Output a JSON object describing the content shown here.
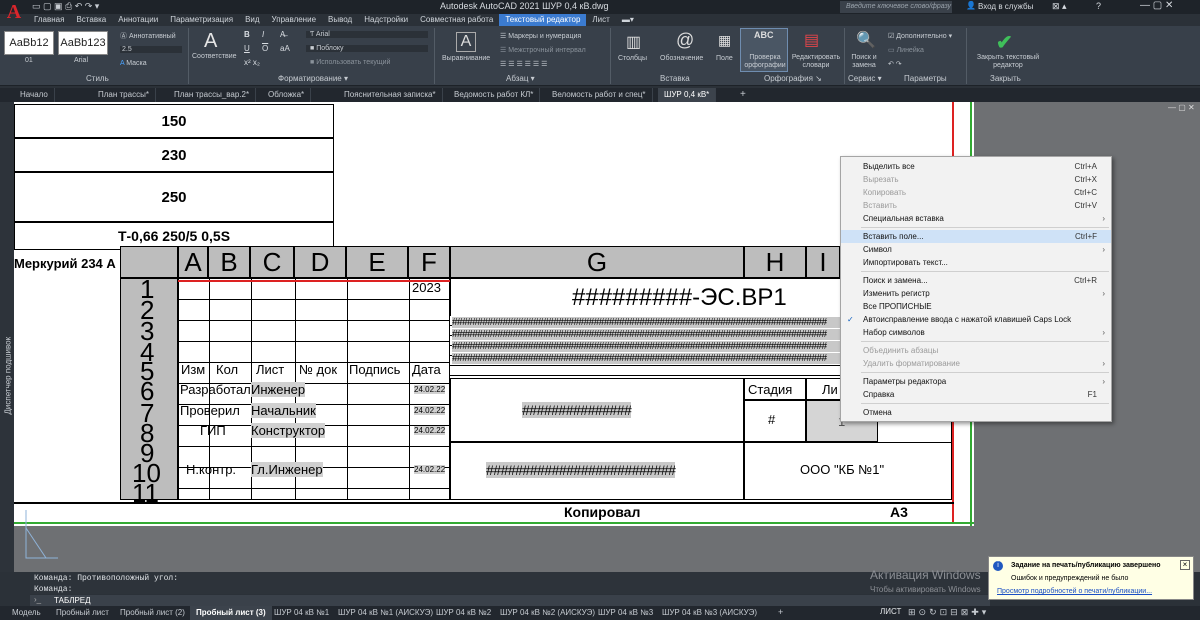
{
  "app": {
    "title": "Autodesk AutoCAD 2021   ШУР 0,4 кВ.dwg",
    "search_placeholder": "Введите ключевое слово/фразу",
    "signin": "Вход в службы",
    "help": "?"
  },
  "menu_tabs": [
    "Главная",
    "Вставка",
    "Аннотации",
    "Параметризация",
    "Вид",
    "Управление",
    "Вывод",
    "Надстройки",
    "Совместная работа",
    "Текстовый редактор",
    "Лист"
  ],
  "ribbon": {
    "style_samples": [
      "AaBb12",
      "AaBb123"
    ],
    "style_names": [
      "01",
      "Arial"
    ],
    "annotative": "Аннотативный",
    "height": "2.5",
    "mask": "Маска",
    "match": "Соответствие",
    "font": "Arial",
    "color": "Поблоку",
    "use_current": "Использовать текущий",
    "justify": "Выравнивание",
    "bullets": "Маркеры и нумерация",
    "line_spacing": "Межстрочный интервал",
    "columns": "Столбцы",
    "symbol": "Обозначение",
    "field": "Поле",
    "spell": "Проверка орфографии",
    "dict": "Редактировать словари",
    "find": "Поиск и замена",
    "more": "Дополнительно",
    "ruler": "Линейка",
    "close": "Закрыть текстовый редактор",
    "groups": [
      "Стиль",
      "Форматирование",
      "Абзац",
      "Вставка",
      "Орфография",
      "Сервис",
      "Параметры",
      "Закрыть"
    ]
  },
  "doc_tabs": [
    "Начало",
    "План трассы*",
    "План трассы_вар.2*",
    "Обложка*",
    "Пояснительная записка*",
    "Ведомость работ КЛ*",
    "Веломость работ и спец*",
    "ШУР 0,4 кВ*"
  ],
  "left_panel": "Диспетчер подшивок",
  "drawing": {
    "upper_rows": [
      "150",
      "230",
      "250",
      "Т-0,66 250/5 0,5S"
    ],
    "partial": "Меркурий 234 А",
    "col_letters": [
      "A",
      "B",
      "C",
      "D",
      "E",
      "F",
      "G",
      "H",
      "I"
    ],
    "row_numbers": [
      "1",
      "2",
      "3",
      "4",
      "5",
      "6",
      "7",
      "8",
      "9",
      "10",
      "11"
    ],
    "year": "2023",
    "code": "#########-ЭС.ВР1",
    "header_labels": [
      "Изм",
      "Кол",
      "Лист",
      "№ док",
      "Подпись",
      "Дата"
    ],
    "roles": [
      "Разработал",
      "Проверил",
      "ГИП",
      "Н.контр."
    ],
    "names": [
      "Инженер",
      "Начальник",
      "Конструктор",
      "Гл.Инженер"
    ],
    "dates": [
      "24.02.22",
      "24.02.22",
      "24.02.22",
      "24.02.22"
    ],
    "hashes_long": "##########################################################################",
    "hash_mid": "###############",
    "hash_bottom": "##########################",
    "stage": "Стадия",
    "sheet": "Ли",
    "stage_val": "#",
    "sheet_val": "1",
    "company": "ООО \"КБ №1\"",
    "copied": "Копировал",
    "format": "А3"
  },
  "context_menu": [
    {
      "label": "Выделить все",
      "shortcut": "Ctrl+A",
      "disabled": false
    },
    {
      "label": "Вырезать",
      "shortcut": "Ctrl+X",
      "disabled": true
    },
    {
      "label": "Копировать",
      "shortcut": "Ctrl+C",
      "disabled": true
    },
    {
      "label": "Вставить",
      "shortcut": "Ctrl+V",
      "disabled": true
    },
    {
      "label": "Специальная вставка",
      "shortcut": "",
      "disabled": false,
      "sub": true
    },
    {
      "label": "Вставить поле...",
      "shortcut": "Ctrl+F",
      "disabled": false,
      "hl": true
    },
    {
      "label": "Символ",
      "shortcut": "",
      "disabled": false,
      "sub": true
    },
    {
      "label": "Импортировать текст...",
      "shortcut": "",
      "disabled": false
    },
    {
      "label": "Поиск и замена...",
      "shortcut": "Ctrl+R",
      "disabled": false
    },
    {
      "label": "Изменить регистр",
      "shortcut": "",
      "disabled": false,
      "sub": true
    },
    {
      "label": "Все ПРОПИСНЫЕ",
      "shortcut": "",
      "disabled": false
    },
    {
      "label": "Автоисправление ввода с нажатой клавишей Caps Lock",
      "shortcut": "",
      "disabled": false,
      "check": true
    },
    {
      "label": "Набор символов",
      "shortcut": "",
      "disabled": false,
      "sub": true
    },
    {
      "label": "Объединить абзацы",
      "shortcut": "",
      "disabled": true
    },
    {
      "label": "Удалить форматирование",
      "shortcut": "",
      "disabled": true,
      "sub": true
    },
    {
      "label": "Параметры редактора",
      "shortcut": "",
      "disabled": false,
      "sub": true
    },
    {
      "label": "Справка",
      "shortcut": "F1",
      "disabled": false
    },
    {
      "label": "Отмена",
      "shortcut": "",
      "disabled": false
    }
  ],
  "command": {
    "line1": "Команда: Противоположный угол:",
    "line2": "Команда:",
    "input": "ТАБЛРЕД"
  },
  "layout_tabs": [
    "Модель",
    "Пробный лист",
    "Пробный лист (2)",
    "Пробный лист (3)",
    "ШУР 04 кВ №1",
    "ШУР 04 кВ №1 (АИСКУЭ)",
    "ШУР 04 кВ №2",
    "ШУР 04 кВ №2 (АИСКУЭ)",
    "ШУР 04 кВ №3",
    "ШУР 04 кВ №3 (АИСКУЭ)"
  ],
  "status": {
    "mode": "ЛИСТ"
  },
  "watermark": {
    "line1": "Активация Windows",
    "line2": "Чтобы активировать Windows"
  },
  "notification": {
    "title": "Задание на печать/публикацию завершено",
    "body": "Ошибок и предупреждений не было",
    "link": "Просмотр подробностей о печати/публикации..."
  }
}
